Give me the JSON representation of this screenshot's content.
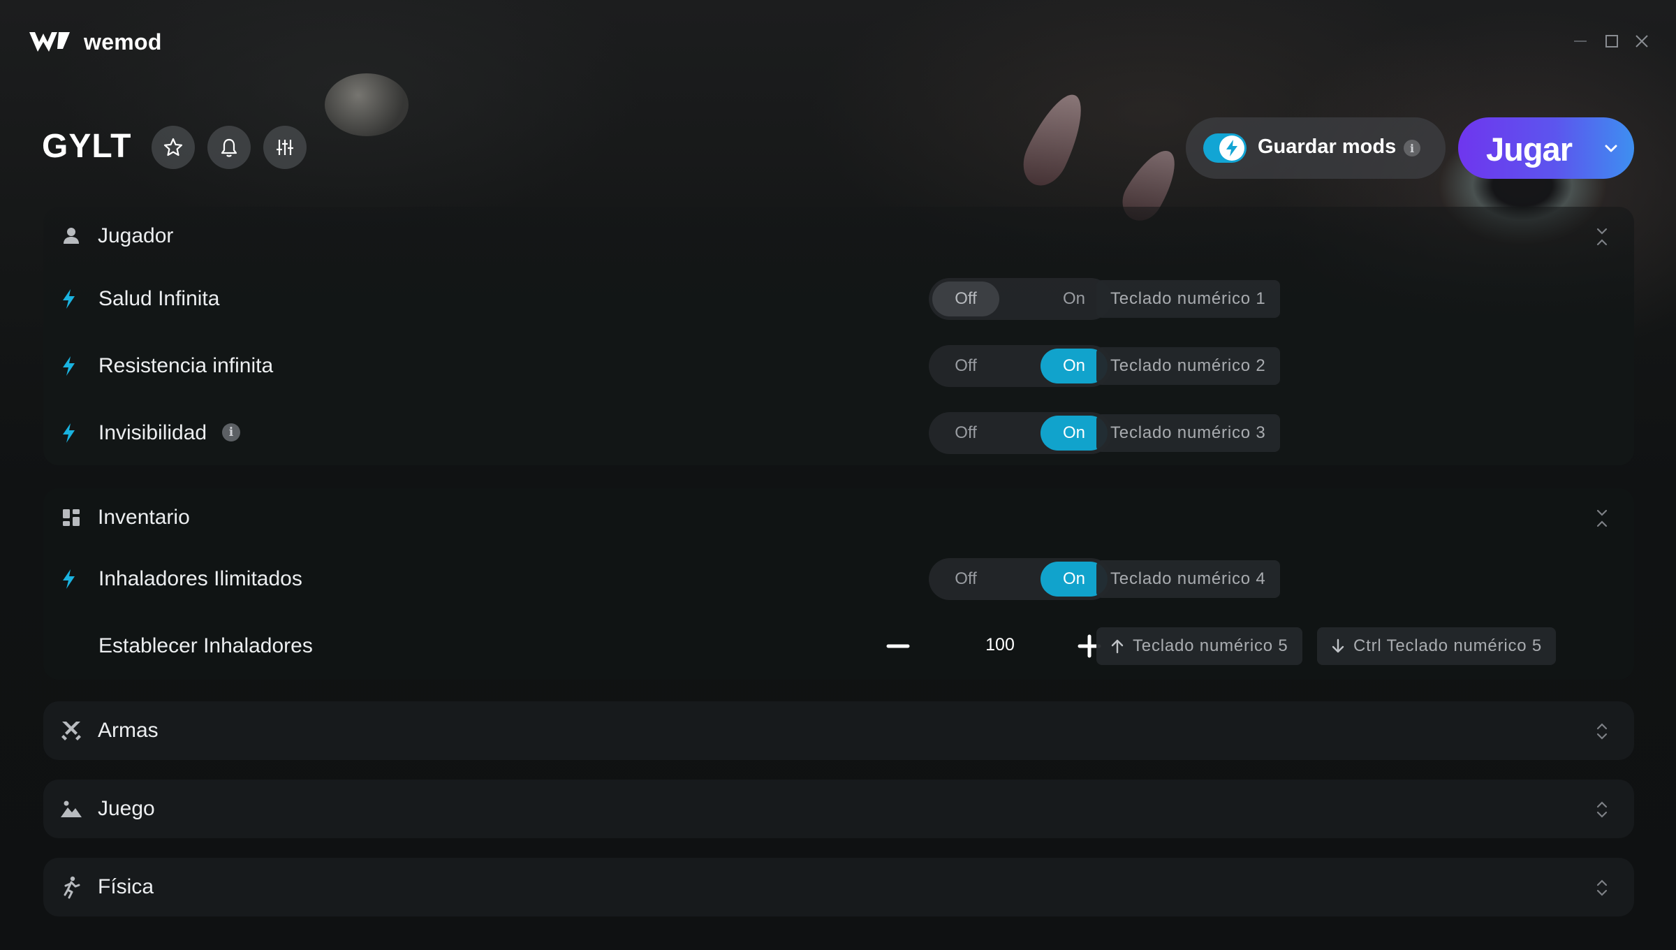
{
  "app": {
    "brand": "wemod"
  },
  "game": {
    "title": "GYLT"
  },
  "header": {
    "save_mods_label": "Guardar mods",
    "save_mods_enabled": true,
    "info_glyph": "i",
    "play_label": "Jugar"
  },
  "categories": [
    {
      "title": "Jugador",
      "icon": "person-icon",
      "expanded": true,
      "mods": [
        {
          "label": "Salud Infinita",
          "off_label": "Off",
          "on_label": "On",
          "state": "off",
          "hotkey": "Teclado numérico 1"
        },
        {
          "label": "Resistencia infinita",
          "off_label": "Off",
          "on_label": "On",
          "state": "on",
          "hotkey": "Teclado numérico 2"
        },
        {
          "label": "Invisibilidad",
          "off_label": "Off",
          "on_label": "On",
          "state": "on",
          "hotkey": "Teclado numérico 3",
          "has_info": true
        }
      ]
    },
    {
      "title": "Inventario",
      "icon": "grid-icon",
      "expanded": true,
      "mods": [
        {
          "label": "Inhaladores Ilimitados",
          "off_label": "Off",
          "on_label": "On",
          "state": "on",
          "hotkey": "Teclado numérico 4"
        },
        {
          "label": "Establecer Inhaladores",
          "type": "stepper",
          "value": "100",
          "hotkey_up": "Teclado numérico 5",
          "hotkey_down": "Ctrl Teclado numérico 5"
        }
      ]
    },
    {
      "title": "Armas",
      "icon": "crossed-swords-icon",
      "expanded": false
    },
    {
      "title": "Juego",
      "icon": "landscape-icon",
      "expanded": false
    },
    {
      "title": "Física",
      "icon": "running-person-icon",
      "expanded": false
    }
  ],
  "colors": {
    "accent": "#11a3cc",
    "bolt": "#1ab3e0",
    "play_gradient_start": "#6f36ee",
    "play_gradient_end": "#3e8ff0"
  }
}
